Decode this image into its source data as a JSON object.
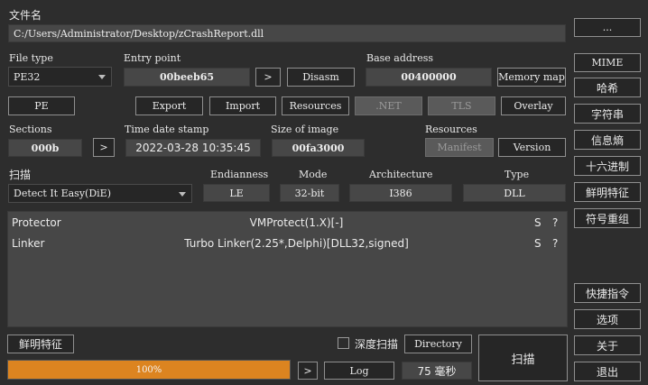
{
  "file": {
    "label": "文件名",
    "path": "C:/Users/Administrator/Desktop/zCrashReport.dll",
    "browse_label": "..."
  },
  "file_type": {
    "label": "File type",
    "value": "PE32"
  },
  "entry_point": {
    "label": "Entry point",
    "value": "00beeb65",
    "go_label": ">",
    "disasm_label": "Disasm"
  },
  "base_address": {
    "label": "Base address",
    "value": "00400000",
    "memory_map_label": "Memory map"
  },
  "sections_row": {
    "pe": "PE",
    "export": "Export",
    "import": "Import",
    "resources": "Resources",
    "net": ".NET",
    "tls": "TLS",
    "overlay": "Overlay"
  },
  "sections": {
    "label": "Sections",
    "value": "000b",
    "go_label": ">"
  },
  "time_date_stamp": {
    "label": "Time date stamp",
    "value": "2022-03-28 10:35:45"
  },
  "size_of_image": {
    "label": "Size of image",
    "value": "00fa3000"
  },
  "resources_group": {
    "label": "Resources",
    "manifest": "Manifest",
    "version": "Version"
  },
  "scan": {
    "label": "扫描",
    "engine": "Detect It Easy(DiE)",
    "endianness": {
      "label": "Endianness",
      "value": "LE"
    },
    "mode": {
      "label": "Mode",
      "value": "32-bit"
    },
    "architecture": {
      "label": "Architecture",
      "value": "I386"
    },
    "type": {
      "label": "Type",
      "value": "DLL"
    }
  },
  "results": [
    {
      "type": "Protector",
      "name": "VMProtect(1.X)[-]",
      "s": "S",
      "q": "?"
    },
    {
      "type": "Linker",
      "name": "Turbo Linker(2.25*,Delphi)[DLL32,signed]",
      "s": "S",
      "q": "?"
    }
  ],
  "bottom": {
    "signatures": "鲜明特征",
    "deep_scan": "深度扫描",
    "deep_scan_checked": false,
    "directory": "Directory",
    "scan": "扫描",
    "progress_text": "100%",
    "progress_value": 1.0,
    "progress_go": ">",
    "log": "Log",
    "elapsed": "75 毫秒"
  },
  "side": {
    "mime": "MIME",
    "hash": "哈希",
    "strings": "字符串",
    "entropy": "信息熵",
    "hex": "十六进制",
    "signatures": "鲜明特征",
    "symbols": "符号重组",
    "shortcuts": "快捷指令",
    "options": "选项",
    "about": "关于",
    "exit": "退出"
  },
  "colors": {
    "accent": "#dc8420",
    "background": "#2d2d2d",
    "field": "#474747"
  }
}
